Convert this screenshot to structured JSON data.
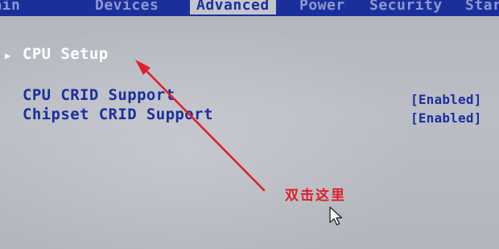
{
  "tabs": [
    {
      "label": "Main"
    },
    {
      "label": "Devices"
    },
    {
      "label": "Advanced"
    },
    {
      "label": "Power"
    },
    {
      "label": "Security"
    },
    {
      "label": "Startup"
    }
  ],
  "active_tab": "Advanced",
  "menu": {
    "submenu_indicator_icon": "triangle-right-icon",
    "submenu_label": "CPU Setup",
    "settings": [
      {
        "label": "CPU CRID Support",
        "value": "[Enabled]"
      },
      {
        "label": "Chipset CRID Support",
        "value": "[Enabled]"
      }
    ]
  },
  "annotation": {
    "text": "双击这里",
    "color": "#e0202a",
    "pointer_icon": "mouse-pointer-icon"
  },
  "colors": {
    "tab_bar": "#1b2f9c",
    "screen_bg": "#b9bbc4",
    "selected_text": "#ffffff",
    "setting_text": "#1b2f9c"
  }
}
